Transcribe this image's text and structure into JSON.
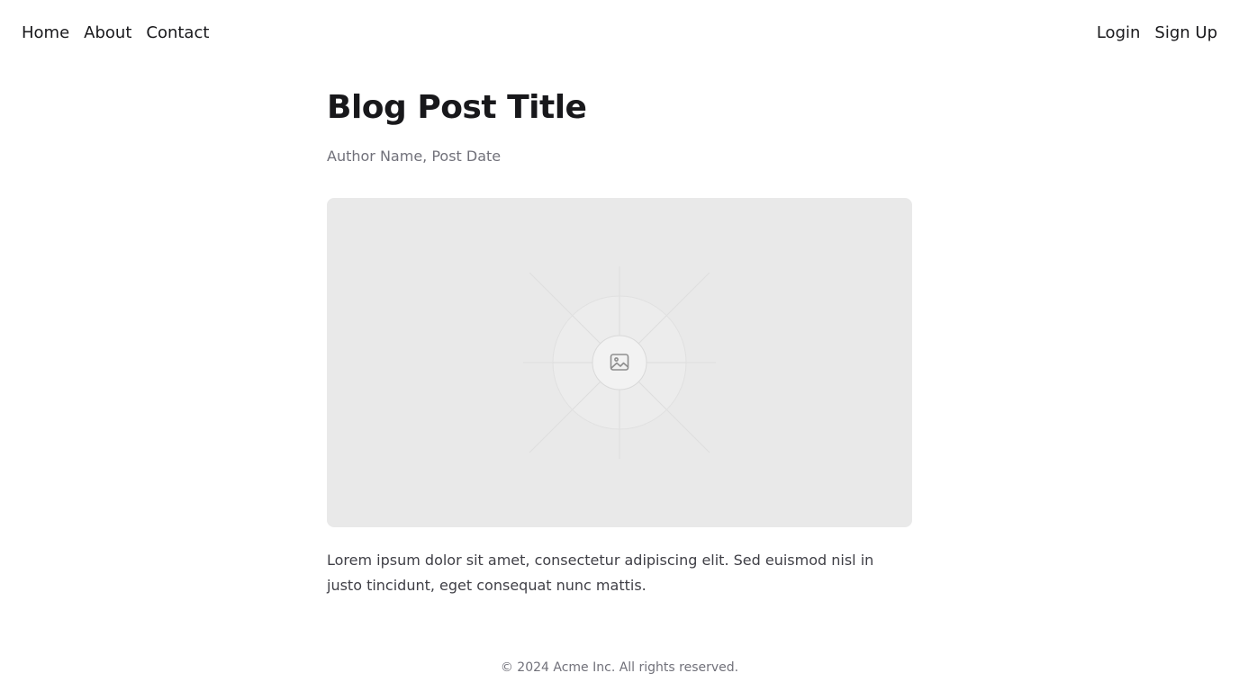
{
  "nav": {
    "left": [
      "Home",
      "About",
      "Contact"
    ],
    "right": [
      "Login",
      "Sign Up"
    ]
  },
  "post": {
    "title": "Blog Post Title",
    "meta": "Author Name, Post Date",
    "image_icon": "image-placeholder-icon",
    "body": "Lorem ipsum dolor sit amet, consectetur adipiscing elit. Sed euismod nisl in justo tincidunt, eget consequat nunc mattis."
  },
  "footer": {
    "text": "© 2024 Acme Inc. All rights reserved."
  },
  "colors": {
    "text": "#18181b",
    "muted": "#71717a",
    "body_text": "#3f3f46",
    "placeholder_bg": "#e9e9e9"
  }
}
